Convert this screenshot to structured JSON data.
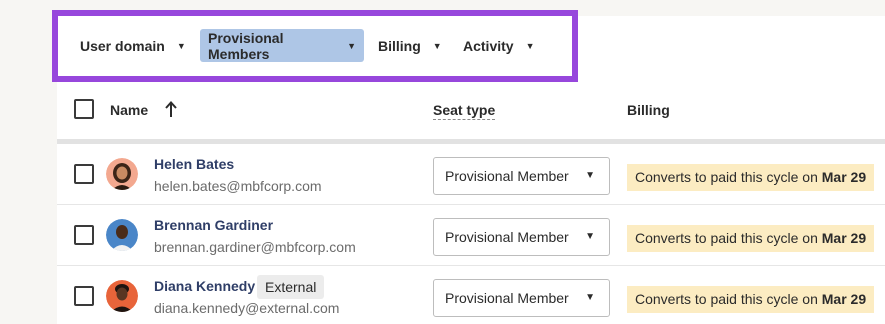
{
  "filters": [
    {
      "label": "User domain",
      "active": false
    },
    {
      "label": "Provisional Members",
      "active": true
    },
    {
      "label": "Billing",
      "active": false
    },
    {
      "label": "Activity",
      "active": false
    }
  ],
  "table": {
    "headers": {
      "name": "Name",
      "seat_type": "Seat type",
      "billing": "Billing"
    },
    "rows": [
      {
        "name": "Helen Bates",
        "email": "helen.bates@mbfcorp.com",
        "badge": "",
        "seat_type": "Provisional Member",
        "billing_prefix": "Converts to paid this cycle on ",
        "billing_date": "Mar 29"
      },
      {
        "name": "Brennan Gardiner",
        "email": "brennan.gardiner@mbfcorp.com",
        "badge": "",
        "seat_type": "Provisional Member",
        "billing_prefix": "Converts to paid this cycle on ",
        "billing_date": "Mar 29"
      },
      {
        "name": "Diana Kennedy",
        "email": "diana.kennedy@external.com",
        "badge": "External",
        "seat_type": "Provisional Member",
        "billing_prefix": "Converts to paid this cycle on ",
        "billing_date": "Mar 29"
      }
    ]
  },
  "colors": {
    "highlight_border": "#9747dc",
    "active_filter": "#aec6e6",
    "billing_badge": "#fcecc2",
    "name_link": "#2f3e67"
  },
  "icons": {
    "caret": "caret-down-icon",
    "sort": "arrow-up-icon"
  }
}
